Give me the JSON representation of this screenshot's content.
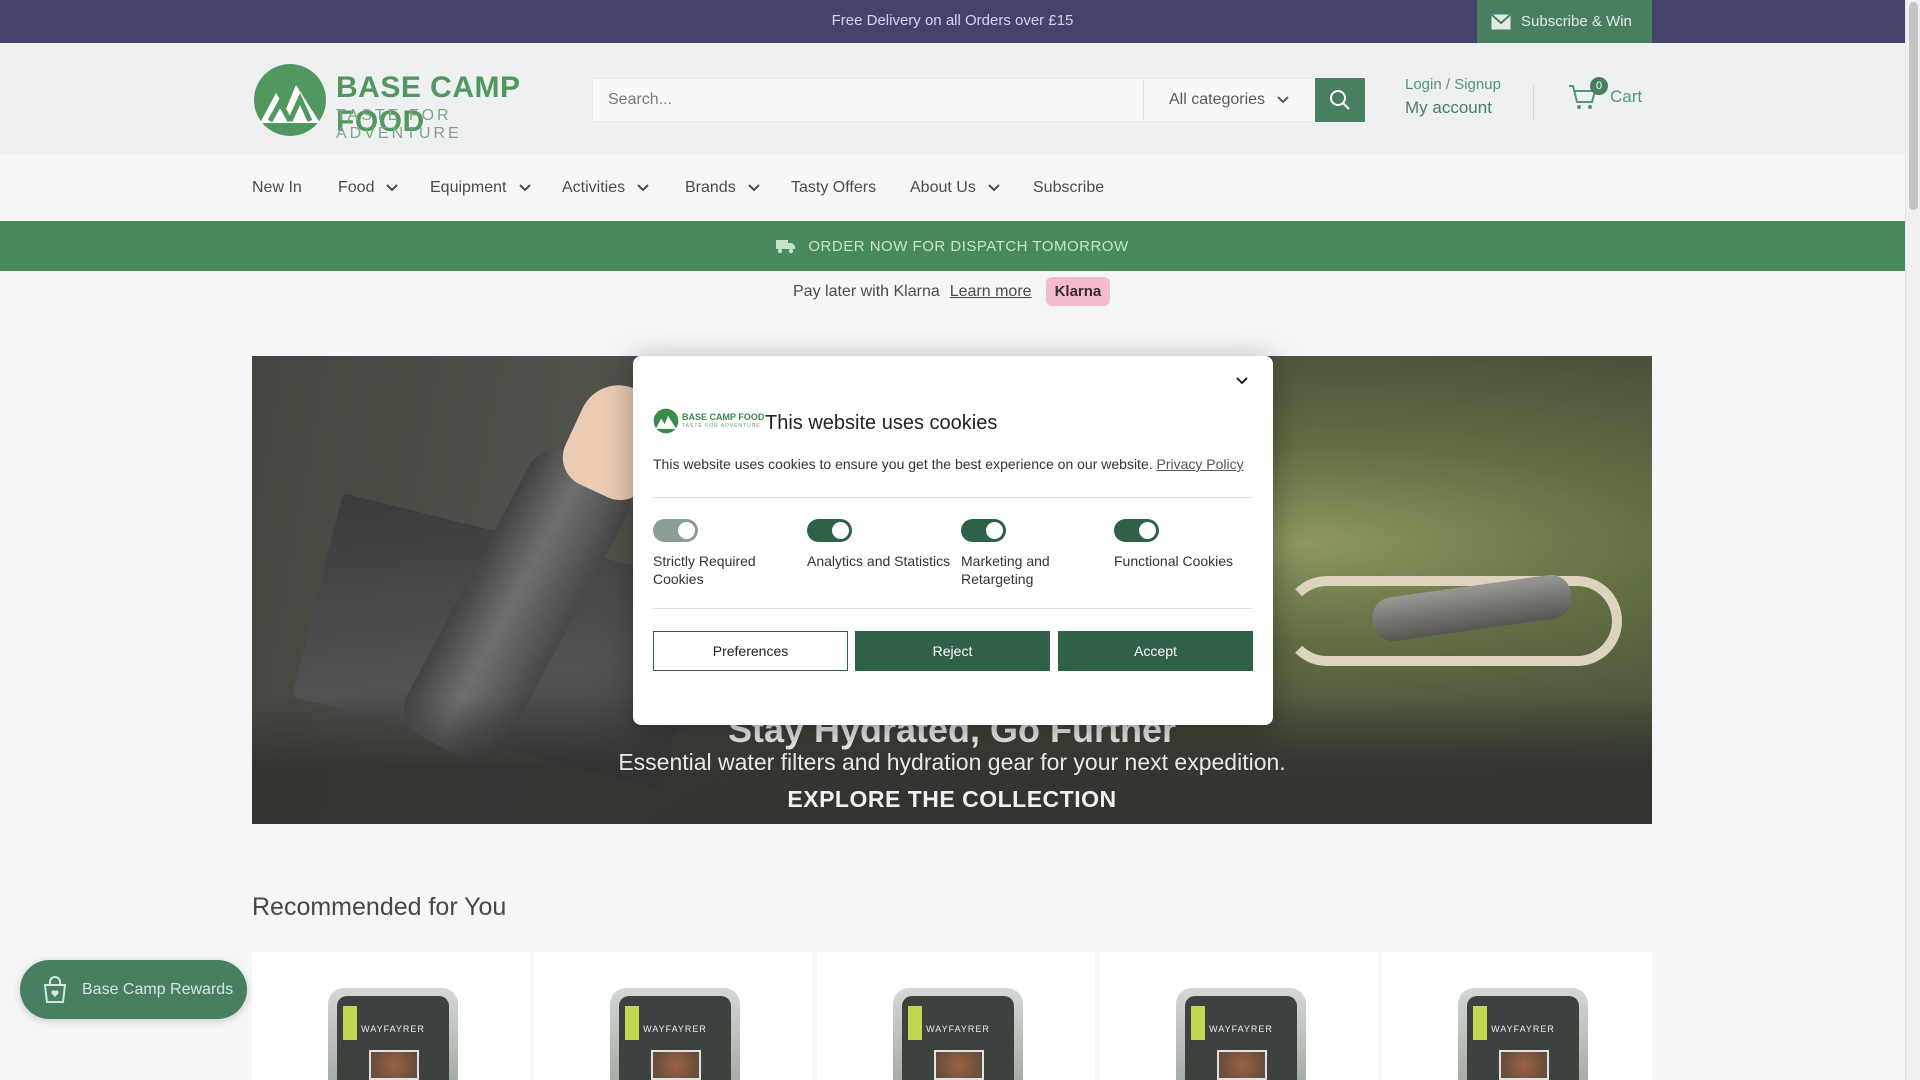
{
  "announcement": {
    "text": "Free Delivery on all Orders over £15",
    "subscribe_label": "Subscribe & Win"
  },
  "header": {
    "logo_name": "BASE CAMP FOOD",
    "logo_tagline": "TASTE FOR ADVENTURE",
    "search_placeholder": "Search...",
    "category_select": "All categories",
    "login_label": "Login / Signup",
    "account_label": "My account",
    "cart_count": "0",
    "cart_label": "Cart"
  },
  "nav": {
    "items": [
      {
        "label": "New In"
      },
      {
        "label": "Food"
      },
      {
        "label": "Equipment"
      },
      {
        "label": "Activities"
      },
      {
        "label": "Brands"
      },
      {
        "label": "Tasty Offers"
      },
      {
        "label": "About Us"
      },
      {
        "label": "Subscribe"
      }
    ]
  },
  "dispatch_text": "ORDER NOW FOR DISPATCH TOMORROW",
  "klarna": {
    "text": "Pay later with Klarna",
    "link": "Learn more",
    "badge": "Klarna"
  },
  "hero": {
    "title": "Stay Hydrated, Go Further",
    "subtitle": "Essential water filters and hydration gear for your next expedition.",
    "cta": "EXPLORE THE COLLECTION"
  },
  "recommended": {
    "title": "Recommended for You",
    "product_brand": "WAYFAYRER"
  },
  "rewards_label": "Base Camp Rewards",
  "cookie_modal": {
    "logo_name": "BASE CAMP FOOD",
    "logo_tagline": "TASTE FOR ADVENTURE",
    "title": "This website uses cookies",
    "description": "This website uses cookies to ensure you get the best experience on our website.",
    "privacy_link": "Privacy Policy",
    "toggles": [
      {
        "label": "Strictly Required Cookies",
        "checked": true,
        "disabled": true
      },
      {
        "label": "Analytics and Statistics",
        "checked": true,
        "disabled": false
      },
      {
        "label": "Marketing and Retargeting",
        "checked": true,
        "disabled": false
      },
      {
        "label": "Functional Cookies",
        "checked": true,
        "disabled": false
      }
    ],
    "preferences_label": "Preferences",
    "reject_label": "Reject",
    "accept_label": "Accept"
  },
  "colors": {
    "announcement_bg": "#2b2a5a",
    "brand_green": "#2f6e4a",
    "dispatch_green": "#2f7a45",
    "klarna_pink": "#f5b2c8"
  }
}
